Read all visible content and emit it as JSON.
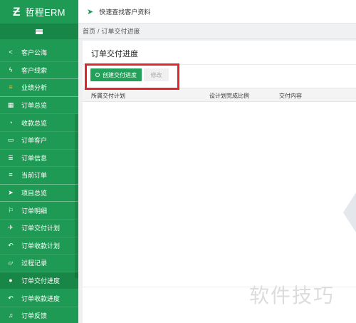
{
  "brand": {
    "logo": "Ƶ",
    "name": "哲程ERM"
  },
  "topbar": {
    "quick_search": "快速查找客户资料"
  },
  "breadcrumb": {
    "home": "首页",
    "sep": "/",
    "current": "订单交付进度"
  },
  "sidebar": {
    "items": [
      {
        "label": "客户公海",
        "icon": "share-icon",
        "glyph": "<"
      },
      {
        "label": "客户线索",
        "icon": "bolt-icon",
        "glyph": "ϟ"
      },
      {
        "label": "业绩分析",
        "icon": "list-icon",
        "glyph": "≡"
      },
      {
        "label": "订单总览",
        "icon": "grid-icon",
        "glyph": "▦"
      },
      {
        "label": "收款总览",
        "icon": "rss-icon",
        "glyph": "◔"
      },
      {
        "label": "订单客户",
        "icon": "laptop-icon",
        "glyph": "▭"
      },
      {
        "label": "订单信息",
        "icon": "database-icon",
        "glyph": "≣"
      },
      {
        "label": "当前订单",
        "icon": "menu-icon",
        "glyph": "≡"
      },
      {
        "label": "项目总览",
        "icon": "location-arrow-icon",
        "glyph": "➤"
      },
      {
        "label": "订单明细",
        "icon": "flag-icon",
        "glyph": "⚐"
      },
      {
        "label": "订单交付计划",
        "icon": "paper-plane-icon",
        "glyph": "✈"
      },
      {
        "label": "订单收款计划",
        "icon": "reply-icon",
        "glyph": "↶"
      },
      {
        "label": "过程记录",
        "icon": "folder-icon",
        "glyph": "▱"
      },
      {
        "label": "订单交付进度",
        "icon": "circle-icon",
        "glyph": "●"
      },
      {
        "label": "订单收款进度",
        "icon": "reply-icon",
        "glyph": "↶"
      },
      {
        "label": "订单反馈",
        "icon": "bell-icon",
        "glyph": "♫"
      }
    ]
  },
  "panel": {
    "title": "订单交付进度",
    "create_button": "创建交付进度",
    "edit_button": "修改",
    "columns": [
      "所属交付计划",
      "设计划完成比例",
      "交付内容"
    ]
  },
  "watermark": "软件技巧",
  "colors": {
    "sidebar": "#1f9a54",
    "accent": "#23a05a",
    "highlight_box": "#e0262a"
  }
}
